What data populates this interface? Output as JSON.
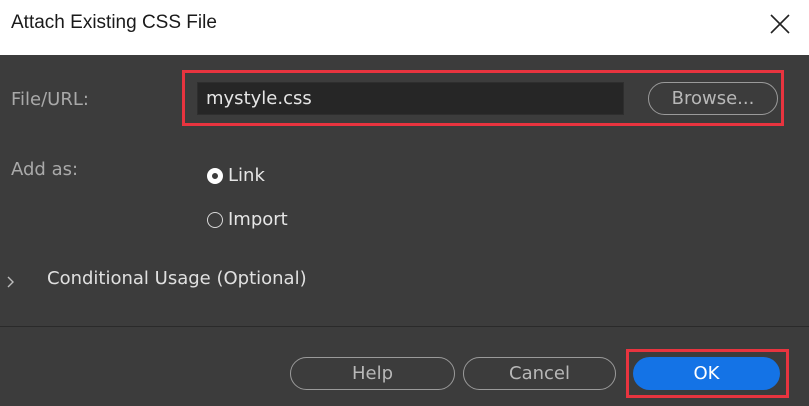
{
  "window": {
    "title": "Attach Existing CSS File",
    "close_icon": "close-icon"
  },
  "file": {
    "label": "File/URL:",
    "value": "mystyle.css",
    "browse_label": "Browse..."
  },
  "add_as": {
    "label": "Add as:",
    "options": [
      {
        "label": "Link",
        "selected": true
      },
      {
        "label": "Import",
        "selected": false
      }
    ]
  },
  "conditional": {
    "label": "Conditional Usage (Optional)",
    "icon": "chevron-right-icon"
  },
  "footer": {
    "help_label": "Help",
    "cancel_label": "Cancel",
    "ok_label": "OK"
  },
  "colors": {
    "dialog_bg": "#3c3c3c",
    "accent": "#1473e6",
    "highlight": "#e8343f"
  }
}
